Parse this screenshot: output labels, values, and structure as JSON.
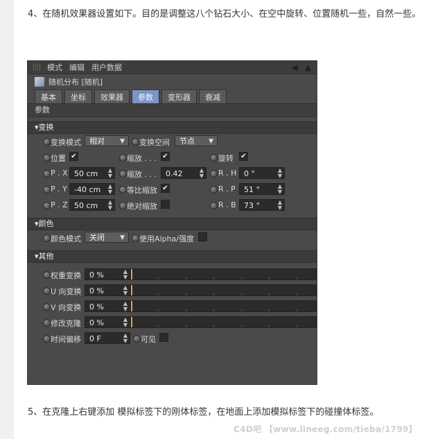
{
  "article": {
    "paragraph_1": "4、在随机效果器设置如下。目的是调整这八个钻石大小、在空中旋转、位置随机一些，自然一些。",
    "paragraph_2": "5、在克隆上右键添加 模拟标签下的刚体标签，在地面上添加模拟标签下的碰撞体标签。",
    "watermark": "C4D吧 【www.lineeg.com/tieba/1799】"
  },
  "panel": {
    "menubar": [
      "模式",
      "编辑",
      "用户数据"
    ],
    "object_title": "随机分布 [随机]",
    "tabs": [
      "基本",
      "坐标",
      "效果器",
      "参数",
      "变形器",
      "衰减"
    ],
    "active_tab": "参数",
    "section_title": "参数",
    "groups": {
      "transform": {
        "title": "▾变换",
        "transform_mode_label": "变换模式",
        "transform_mode_value": "相对",
        "transform_space_label": "变换空间",
        "transform_space_value": "节点",
        "position_label": "位置",
        "scale_label": "缩放 . . .",
        "rotation_label": "旋转",
        "px_label": "P . X",
        "px_value": "50 cm",
        "py_label": "P . Y",
        "py_value": "-40 cm",
        "pz_label": "P . Z",
        "pz_value": "50 cm",
        "scale_value_label": "缩放 . . .",
        "scale_value": "0.42",
        "uniform_scale_label": "等比缩放",
        "absolute_scale_label": "绝对缩放",
        "rh_label": "R . H",
        "rh_value": "0 °",
        "rp_label": "R . P",
        "rp_value": "51 °",
        "rb_label": "R . B",
        "rb_value": "73 °"
      },
      "color": {
        "title": "▾颜色",
        "color_mode_label": "颜色模式",
        "color_mode_value": "关闭",
        "use_alpha_label": "使用Alpha/强度"
      },
      "other": {
        "title": "▾其他",
        "rows": [
          {
            "label": "权重变换",
            "value": "0 %"
          },
          {
            "label": "U 向变换",
            "value": "0 %"
          },
          {
            "label": "V 向变换",
            "value": "0 %"
          },
          {
            "label": "修改克隆",
            "value": "0 %"
          }
        ],
        "time_offset_label": "时间偏移",
        "time_offset_value": "0 F",
        "visible_label": "可见"
      }
    },
    "colors": {
      "panel_bg": "#4a4a4a",
      "active_tab": "#7c95c6",
      "slider_fill": "#e8a33a"
    }
  }
}
